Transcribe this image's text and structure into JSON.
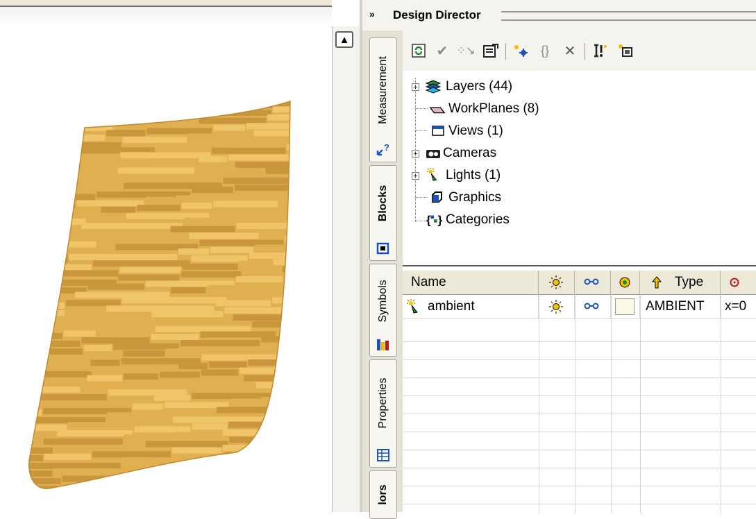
{
  "panel": {
    "title": "Design Director",
    "collapse_glyph": "»"
  },
  "side_tabs": [
    {
      "label": "Measurement",
      "icon": "measurement-icon"
    },
    {
      "label": "Blocks",
      "icon": "blocks-icon"
    },
    {
      "label": "Symbols",
      "icon": "symbols-icon"
    },
    {
      "label": "Properties",
      "icon": "properties-icon"
    },
    {
      "label": "lors",
      "icon": "colors-icon"
    }
  ],
  "toolbar": {
    "buttons": [
      {
        "icon": "refresh-icon",
        "glyph": "↻"
      },
      {
        "icon": "check-icon",
        "glyph": "✔"
      },
      {
        "icon": "select-objects-icon",
        "glyph": "⋰"
      },
      {
        "icon": "properties-sheet-icon",
        "glyph": "▤"
      },
      {
        "icon": "new-light-icon",
        "glyph": "✱"
      },
      {
        "icon": "new-category-icon",
        "glyph": "{}"
      },
      {
        "icon": "delete-icon",
        "glyph": "✕"
      },
      {
        "icon": "tools-icon",
        "glyph": "⚒"
      },
      {
        "icon": "new-item-icon",
        "glyph": "▣"
      }
    ]
  },
  "tree": {
    "items": [
      {
        "label": "Layers (44)",
        "icon": "layers-icon",
        "expandable": true
      },
      {
        "label": "WorkPlanes (8)",
        "icon": "workplane-icon",
        "expandable": false
      },
      {
        "label": "Views (1)",
        "icon": "views-icon",
        "expandable": false
      },
      {
        "label": "Cameras",
        "icon": "camera-icon",
        "expandable": true
      },
      {
        "label": "Lights (1)",
        "icon": "light-icon",
        "expandable": true
      },
      {
        "label": "Graphics",
        "icon": "graphics-icon",
        "expandable": false
      },
      {
        "label": "Categories",
        "icon": "categories-icon",
        "expandable": false
      }
    ]
  },
  "grid": {
    "columns": [
      {
        "label": "Name"
      },
      {
        "label": "",
        "icon": "light-on-icon"
      },
      {
        "label": "",
        "icon": "link-icon"
      },
      {
        "label": "",
        "icon": "color-icon"
      },
      {
        "label": "Type",
        "icon": "direction-icon"
      },
      {
        "label": "",
        "icon": "position-icon"
      }
    ],
    "rows": [
      {
        "name": "ambient",
        "type": "AMBIENT",
        "position": "x=0"
      }
    ]
  },
  "colors": {
    "surface": "#e0b050",
    "surface_dark": "#c9963c",
    "surface_light": "#f0c468"
  }
}
